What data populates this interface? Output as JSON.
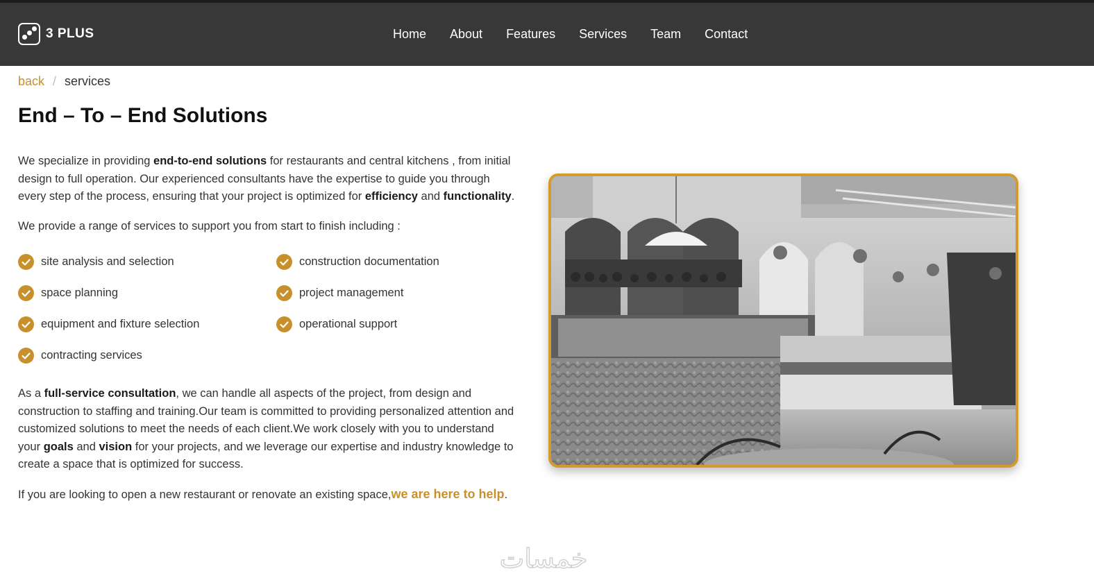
{
  "brand": {
    "name": "3 PLUS"
  },
  "nav": {
    "items": [
      {
        "label": "Home"
      },
      {
        "label": "About"
      },
      {
        "label": "Features"
      },
      {
        "label": "Services"
      },
      {
        "label": "Team"
      },
      {
        "label": "Contact"
      }
    ]
  },
  "breadcrumb": {
    "back": "back",
    "separator": "/",
    "current": "services"
  },
  "page": {
    "title": "End – To – End Solutions",
    "intro": {
      "t1": "We specialize in providing ",
      "b1": "end-to-end solutions",
      "t2": " for restaurants and central kitchens , from initial design to full operation. Our experienced consultants have the expertise to guide you through every step of the process, ensuring that your project is optimized for ",
      "b2": "efficiency",
      "t3": " and ",
      "b3": "functionality",
      "t4": "."
    },
    "range_text": "We provide a range of services to support you from start to finish including :",
    "services": [
      "site analysis and selection",
      "construction documentation",
      "space planning",
      "project management",
      "equipment and fixture selection",
      "operational support",
      "contracting services"
    ],
    "consult": {
      "t1": "As a ",
      "b1": "full-service consultation",
      "t2": ", we can handle all aspects of the project, from design and construction to staffing and training.Our team is committed to providing personalized attention and customized solutions to meet the needs of each client.We work closely with you to understand your ",
      "b2": "goals",
      "t3": " and ",
      "b3": "vision",
      "t4": " for your projects, and we leverage our expertise and industry knowledge to create a space that is optimized for success."
    },
    "closing": {
      "text": "If you are looking to open a new restaurant or renovate an existing space,",
      "link": "we are here to help",
      "end": "."
    }
  },
  "watermark": {
    "text": "خمسات"
  },
  "colors": {
    "accent": "#c8902c",
    "nav_bg": "#383838",
    "frame": "#d49a2c"
  },
  "icons": {
    "service_bullet": "check-circle-icon",
    "logo": "dice-icon"
  }
}
